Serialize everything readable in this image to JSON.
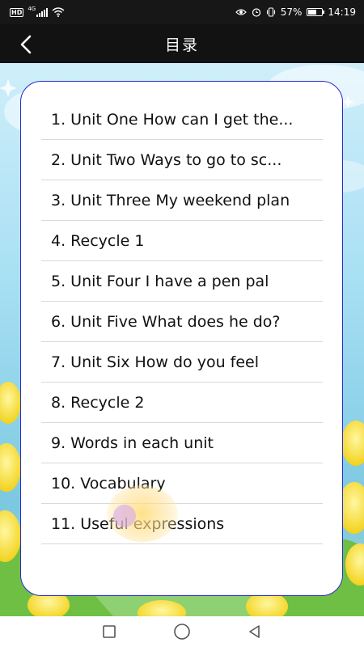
{
  "status_bar": {
    "hd": "HD",
    "network": "4G",
    "battery_text": "57%",
    "battery_level": 0.57,
    "time": "14:19",
    "icons": [
      "eye-comfort-icon",
      "alarm-icon",
      "vibrate-icon",
      "battery-icon"
    ]
  },
  "header": {
    "back_icon": "chevron-left-icon",
    "title": "目录"
  },
  "toc": {
    "items": [
      {
        "label": "1. Unit One How can I get the..."
      },
      {
        "label": "2. Unit Two Ways to go to sc..."
      },
      {
        "label": "3. Unit Three My weekend plan"
      },
      {
        "label": "4. Recycle 1"
      },
      {
        "label": "5. Unit Four I have a pen pal"
      },
      {
        "label": "6. Unit Five What does he do?"
      },
      {
        "label": "7. Unit Six How do you feel"
      },
      {
        "label": "8. Recycle 2"
      },
      {
        "label": "9. Words in each unit"
      },
      {
        "label": "10. Vocabulary"
      },
      {
        "label": "11. Useful expressions"
      }
    ]
  },
  "colors": {
    "panel_border": "#2a2ad0",
    "title_bar": "#121212",
    "status_bar": "#171717"
  },
  "nav_bar": {
    "icons": [
      "recents-square-icon",
      "home-circle-icon",
      "back-triangle-icon"
    ]
  }
}
